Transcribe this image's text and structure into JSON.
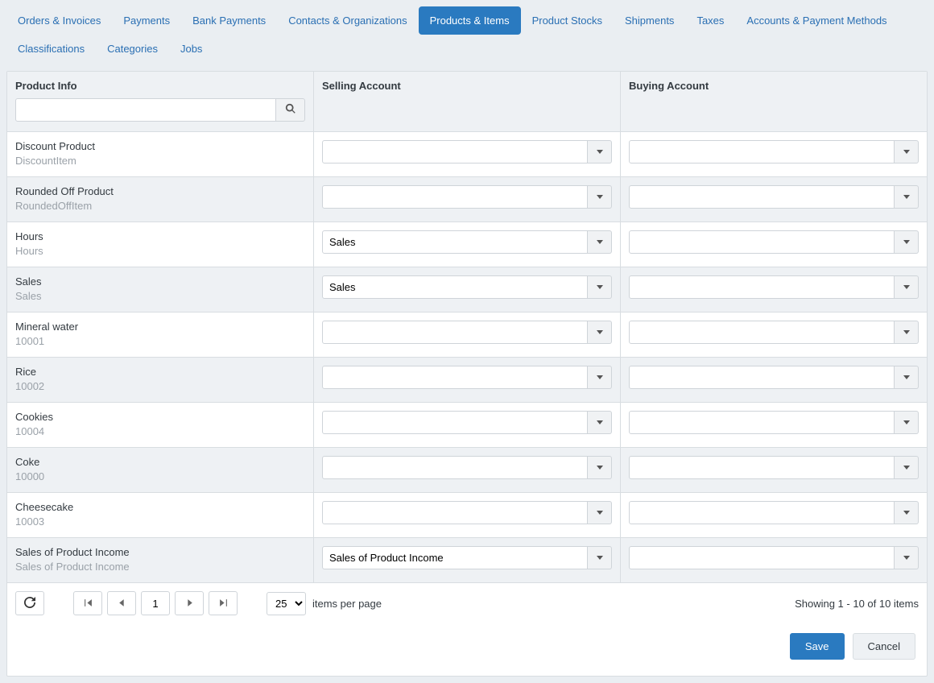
{
  "tabs": [
    {
      "label": "Orders & Invoices",
      "active": false
    },
    {
      "label": "Payments",
      "active": false
    },
    {
      "label": "Bank Payments",
      "active": false
    },
    {
      "label": "Contacts & Organizations",
      "active": false
    },
    {
      "label": "Products & Items",
      "active": true
    },
    {
      "label": "Product Stocks",
      "active": false
    },
    {
      "label": "Shipments",
      "active": false
    },
    {
      "label": "Taxes",
      "active": false
    },
    {
      "label": "Accounts & Payment Methods",
      "active": false
    },
    {
      "label": "Classifications",
      "active": false
    },
    {
      "label": "Categories",
      "active": false
    },
    {
      "label": "Jobs",
      "active": false
    }
  ],
  "columns": {
    "product_info": "Product Info",
    "selling_account": "Selling Account",
    "buying_account": "Buying Account"
  },
  "rows": [
    {
      "name": "Discount Product",
      "sub": "DiscountItem",
      "selling": "",
      "buying": ""
    },
    {
      "name": "Rounded Off Product",
      "sub": "RoundedOffItem",
      "selling": "",
      "buying": ""
    },
    {
      "name": "Hours",
      "sub": "Hours",
      "selling": "Sales",
      "buying": ""
    },
    {
      "name": "Sales",
      "sub": "Sales",
      "selling": "Sales",
      "buying": ""
    },
    {
      "name": "Mineral water",
      "sub": "10001",
      "selling": "",
      "buying": ""
    },
    {
      "name": "Rice",
      "sub": "10002",
      "selling": "",
      "buying": ""
    },
    {
      "name": "Cookies",
      "sub": "10004",
      "selling": "",
      "buying": ""
    },
    {
      "name": "Coke",
      "sub": "10000",
      "selling": "",
      "buying": ""
    },
    {
      "name": "Cheesecake",
      "sub": "10003",
      "selling": "",
      "buying": ""
    },
    {
      "name": "Sales of Product Income",
      "sub": "Sales of Product Income",
      "selling": "Sales of Product Income",
      "buying": ""
    }
  ],
  "pager": {
    "page": "1",
    "per_page": "25",
    "per_page_label": "items per page",
    "showing": "Showing 1 - 10 of 10 items"
  },
  "actions": {
    "save": "Save",
    "cancel": "Cancel"
  }
}
